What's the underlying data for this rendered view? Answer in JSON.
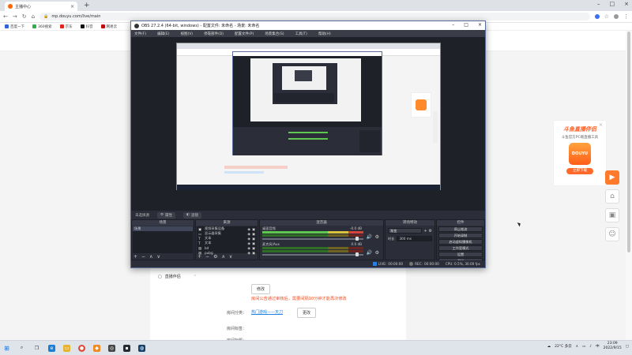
{
  "browser": {
    "tab_title": "主播中心",
    "url": "mp.douyu.com/live/main",
    "bookmarks": [
      {
        "label": "百度一下",
        "color": "#2f63d8"
      },
      {
        "label": "360搜索",
        "color": "#2db14b"
      },
      {
        "label": "京东",
        "color": "#e1251b"
      },
      {
        "label": "抖音",
        "color": "#111111"
      },
      {
        "label": "网易云",
        "color": "#c20c0c"
      }
    ]
  },
  "obs": {
    "window_title": "OBS 27.2.4 (64-bit, windows) - 配置文件: 未命名 - 场景: 未命名",
    "menu": [
      "文件(F)",
      "编辑(E)",
      "视图(V)",
      "停靠部件(D)",
      "配置文件(P)",
      "场景集合(S)",
      "工具(T)",
      "帮助(H)"
    ],
    "source_bar_label": "未选择源",
    "source_bar_props": "属性",
    "source_bar_filters": "滤镜",
    "docks": {
      "scenes": "场景",
      "sources": "来源",
      "mixer": "混音器",
      "transitions": "转场特效",
      "controls": "控件"
    },
    "scene_items": [
      "场景"
    ],
    "source_items": [
      {
        "label": "视频采集设备",
        "icon": "camera"
      },
      {
        "label": "显示器采集",
        "icon": "monitor"
      },
      {
        "label": "文本",
        "icon": "text"
      },
      {
        "label": "文本",
        "icon": "text"
      },
      {
        "label": "bd",
        "icon": "image"
      },
      {
        "label": "pubg",
        "icon": "image"
      }
    ],
    "mixer": [
      {
        "name": "桌面音频",
        "db": "-0.0 dB"
      },
      {
        "name": "麦克风/Aux",
        "db": "0.0 dB"
      }
    ],
    "transition": {
      "value": "渐变",
      "duration_label": "时长",
      "duration": "300 ms"
    },
    "controls": [
      "停止推流",
      "开始录制",
      "启动虚拟摄像机",
      "工作室模式",
      "设置",
      "退出"
    ],
    "status": {
      "live_label": "LIVE:",
      "live_time": "00:00:00",
      "rec_label": "REC:",
      "rec_time": "00:00:00",
      "cpu": "CPU: 0.5%, 30.00 fps"
    }
  },
  "page": {
    "side_item": "直播伴侣",
    "modify_btn": "修改",
    "notice": "房间公告通过审核后，需要间隔10分钟才能再次修改",
    "room_category_label": "房间分类：",
    "room_category_value": "热门游戏——天刀",
    "room_change_btn": "更改",
    "room_tags_label": "房间标签：",
    "room_more_label": "房间标题：",
    "promo_title": "斗鱼直播伴侣",
    "promo_sub": "斗鱼官方PC端直播工具",
    "promo_logo": "DOUYU",
    "promo_btn": "立即下载"
  },
  "taskbar": {
    "weather": "22°C 多云",
    "time": "23:09",
    "date": "2022/9/15",
    "lang": "中"
  }
}
